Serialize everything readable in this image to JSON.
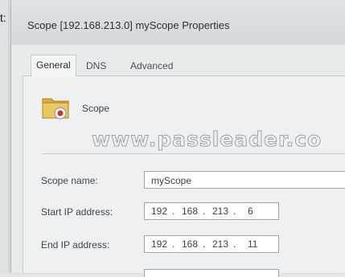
{
  "fragment_text": "t:",
  "window": {
    "title": "Scope [192.168.213.0] myScope Properties"
  },
  "tabs": [
    {
      "label": "General",
      "active": true
    },
    {
      "label": "DNS",
      "active": false
    },
    {
      "label": "Advanced",
      "active": false
    }
  ],
  "scope": {
    "heading": "Scope",
    "icon": "folder-scope-icon"
  },
  "watermark": "www.passleader.co",
  "fields": {
    "scope_name_label": "Scope name:",
    "scope_name_value": "myScope",
    "start_ip_label": "Start IP address:",
    "start_ip": [
      "192",
      "168",
      "213",
      "6"
    ],
    "end_ip_label": "End IP address:",
    "end_ip": [
      "192",
      "168",
      "213",
      "11"
    ]
  },
  "colors": {
    "dialog_bg": "#e8ebec",
    "folder": "#e0b84a",
    "accent_red": "#c0392b"
  }
}
